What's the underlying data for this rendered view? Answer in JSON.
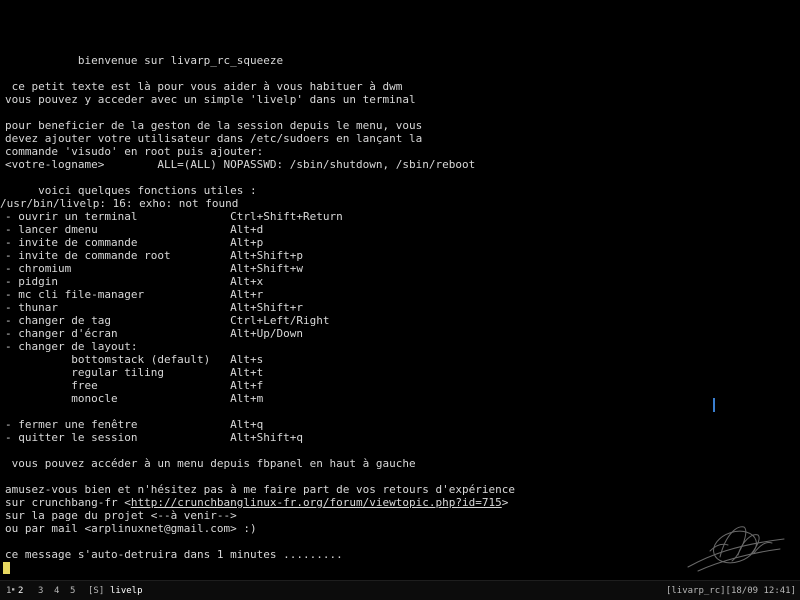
{
  "terminal": {
    "lines": [
      {
        "text": "           bienvenue sur livarp_rc_squeeze"
      },
      {
        "text": ""
      },
      {
        "text": " ce petit texte est là pour vous aider à vous habituer à dwm"
      },
      {
        "text": "vous pouvez y acceder avec un simple 'livelp' dans un terminal"
      },
      {
        "text": ""
      },
      {
        "text": "pour beneficier de la geston de la session depuis le menu, vous"
      },
      {
        "text": "devez ajouter votre utilisateur dans /etc/sudoers en lançant la"
      },
      {
        "text": "commande 'visudo' en root puis ajouter:"
      },
      {
        "text": "<votre-logname>        ALL=(ALL) NOPASSWD: /sbin/shutdown, /sbin/reboot"
      },
      {
        "text": ""
      },
      {
        "text": "     voici quelques fonctions utiles :"
      },
      {
        "text": "/usr/bin/livelp: 16: exho: not found"
      },
      {
        "text": "- ouvrir un terminal              Ctrl+Shift+Return"
      },
      {
        "text": "- lancer dmenu                    Alt+d"
      },
      {
        "text": "- invite de commande              Alt+p"
      },
      {
        "text": "- invite de commande root         Alt+Shift+p"
      },
      {
        "text": "- chromium                        Alt+Shift+w"
      },
      {
        "text": "- pidgin                          Alt+x"
      },
      {
        "text": "- mc cli file-manager             Alt+r"
      },
      {
        "text": "- thunar                          Alt+Shift+r"
      },
      {
        "text": "- changer de tag                  Ctrl+Left/Right"
      },
      {
        "text": "- changer d'écran                 Alt+Up/Down"
      },
      {
        "text": "- changer de layout:"
      },
      {
        "text": "          bottomstack (default)   Alt+s"
      },
      {
        "text": "          regular tiling          Alt+t"
      },
      {
        "text": "          free                    Alt+f"
      },
      {
        "text": "          monocle                 Alt+m"
      },
      {
        "text": ""
      },
      {
        "text": "- fermer une fenêtre              Alt+q"
      },
      {
        "text": "- quitter le session              Alt+Shift+q"
      },
      {
        "text": ""
      },
      {
        "text": " vous pouvez accéder à un menu depuis fbpanel en haut à gauche"
      },
      {
        "text": ""
      },
      {
        "text": "amusez-vous bien et n'hésitez pas à me faire part de vos retours d'expérience"
      },
      {
        "text": "sur crunchbang-fr <http://crunchbanglinux-fr.org/forum/viewtopic.php?id=715>"
      },
      {
        "text": "sur la page du projet <--à venir-->"
      },
      {
        "text": "ou par mail <arplinuxnet@gmail.com> :)"
      },
      {
        "text": ""
      },
      {
        "text": "ce message s'auto-detruira dans 1 minutes ........."
      }
    ],
    "link_url": "http://crunchbanglinux-fr.org/forum/viewtopic.php?id=715",
    "cursor_color": "#e8d860",
    "foreground_color": "#d8d8d8",
    "background_color": "#000000"
  },
  "statusbar": {
    "tags": [
      {
        "label": "1",
        "occupied": true,
        "active": false
      },
      {
        "label": "2",
        "occupied": false,
        "active": true
      },
      {
        "label": "3",
        "occupied": false,
        "active": false
      },
      {
        "label": "4",
        "occupied": false,
        "active": false
      },
      {
        "label": "5",
        "occupied": false,
        "active": false
      }
    ],
    "layout_symbol": "[S]",
    "window_title": "livelp",
    "status_text": "[livarp_rc][18/09 12:41]"
  }
}
